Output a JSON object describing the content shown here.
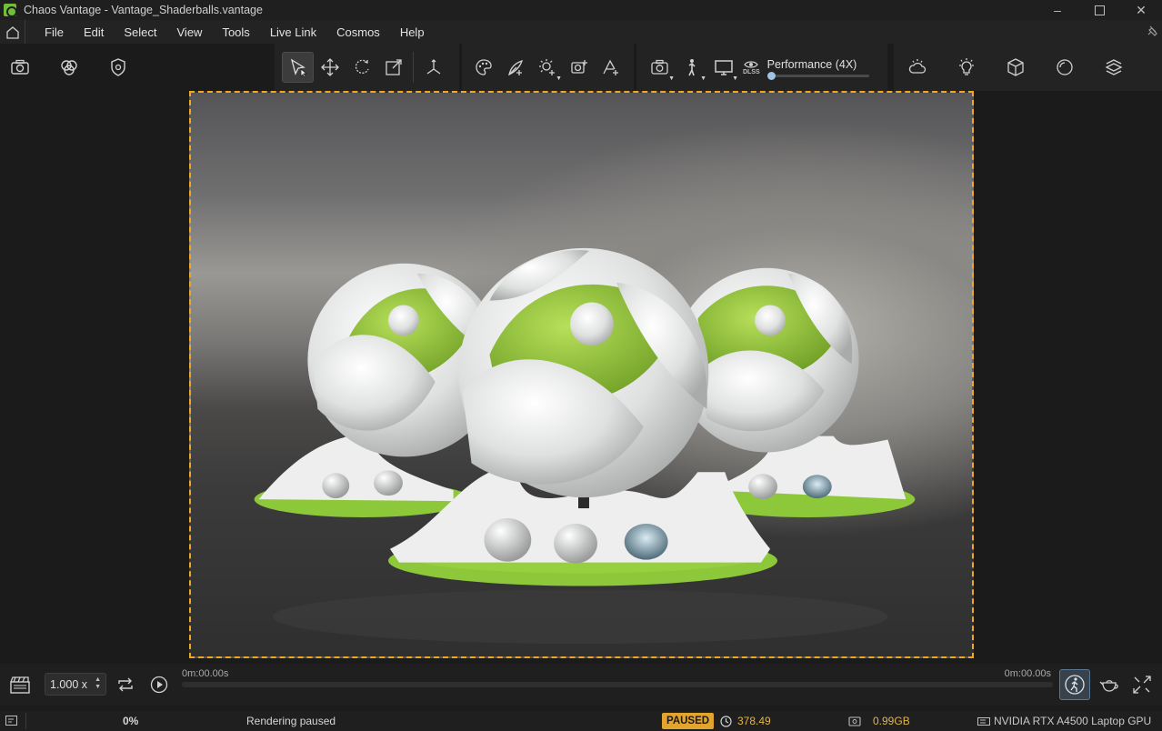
{
  "window": {
    "title": "Chaos Vantage - Vantage_Shaderballs.vantage",
    "controls": [
      "minimize-icon",
      "maximize-icon",
      "close-icon"
    ]
  },
  "menu": {
    "items": [
      "File",
      "Edit",
      "Select",
      "View",
      "Tools",
      "Live Link",
      "Cosmos",
      "Help"
    ]
  },
  "toolbar": {
    "left_tools": [
      "camera-icon",
      "render-passes-icon",
      "settings-shield-icon"
    ],
    "transform_tools": [
      "select-arrow-icon",
      "move-icon",
      "rotate-icon",
      "scale-icon",
      "pivot-icon"
    ],
    "create_tools": [
      "material-palette-icon",
      "add-foliage-icon",
      "add-light-icon",
      "add-asset-icon",
      "add-scatter-icon"
    ],
    "view_tools": [
      "camera-view-icon",
      "walk-mode-icon",
      "display-icon"
    ],
    "dlss_label": "DLSS",
    "performance_label": "Performance (4X)",
    "performance_level": 0,
    "env_tools": [
      "sun-sky-icon",
      "light-bulb-icon",
      "cube-icon",
      "sphere-icon",
      "layers-icon"
    ]
  },
  "timeline": {
    "speed_value": "1.000 x",
    "time_start": "0m:00.00s",
    "time_end": "0m:00.00s"
  },
  "status": {
    "progress": "0%",
    "message": "Rendering paused",
    "badge": "PAUSED",
    "fps": "378.49",
    "memory": "0.99GB",
    "gpu": "NVIDIA RTX A4500 Laptop GPU"
  },
  "colors": {
    "accent_frame": "#f0a723",
    "badge": "#e2a42f",
    "shader_green": "#8cc83a",
    "shader_white": "#e9eaea"
  }
}
